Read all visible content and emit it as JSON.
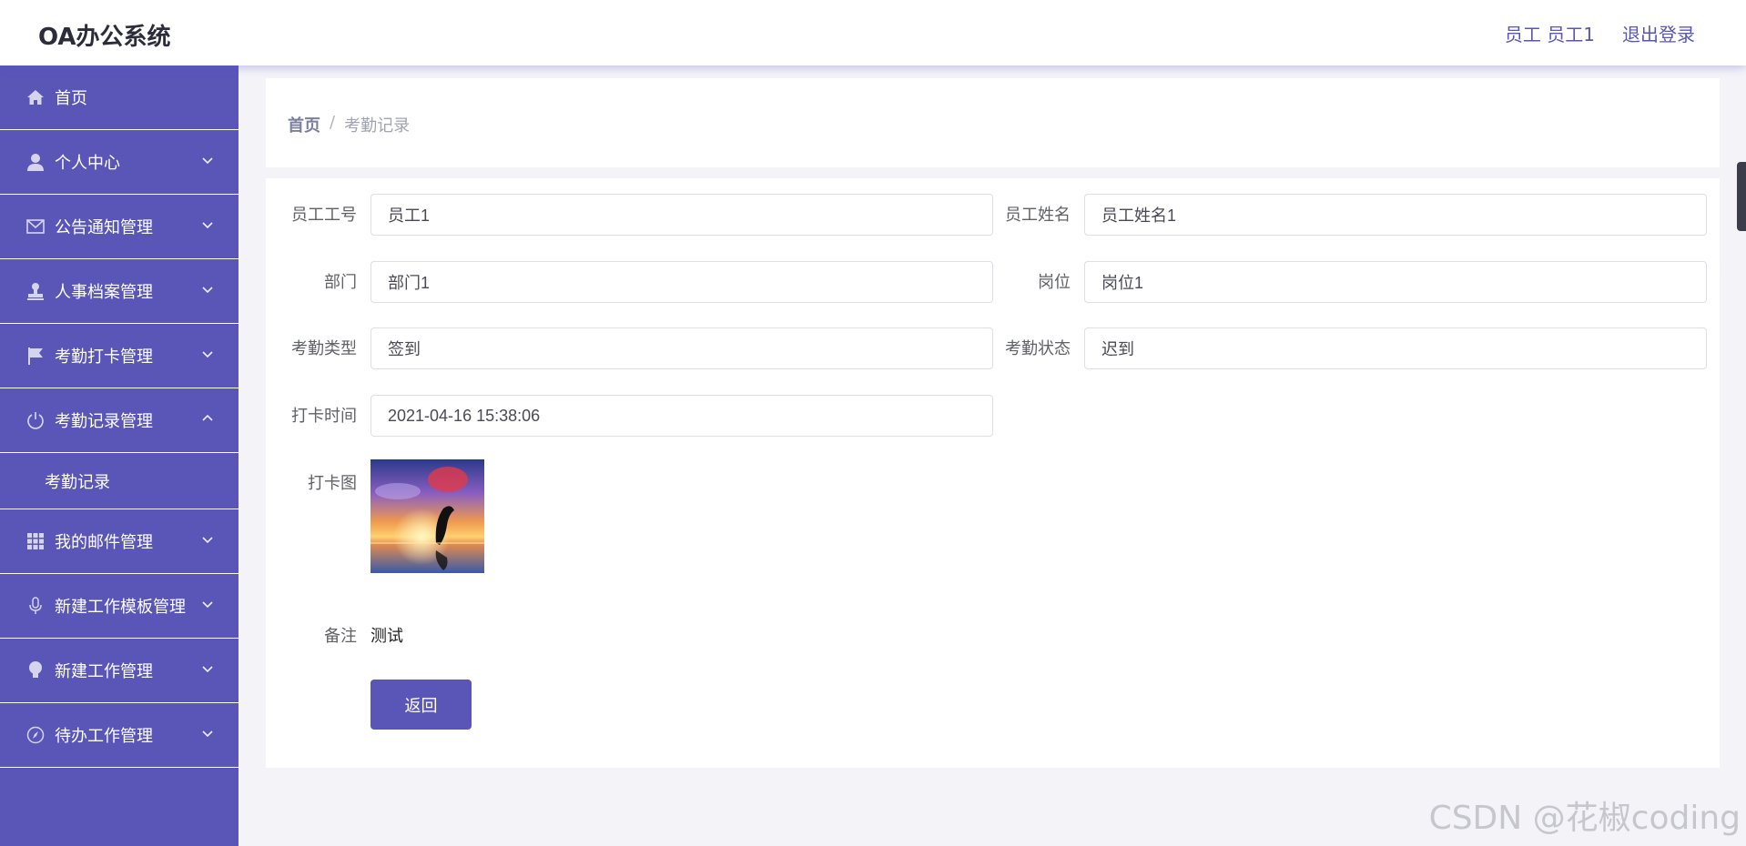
{
  "header": {
    "app_title": "OA办公系统",
    "user_label": "员工 员工1",
    "logout_label": "退出登录"
  },
  "sidebar": {
    "items": [
      {
        "label": "首页",
        "icon": "home-icon"
      },
      {
        "label": "个人中心",
        "icon": "user-icon"
      },
      {
        "label": "公告通知管理",
        "icon": "mail-icon"
      },
      {
        "label": "人事档案管理",
        "icon": "stamp-icon"
      },
      {
        "label": "考勤打卡管理",
        "icon": "flag-icon"
      },
      {
        "label": "考勤记录管理",
        "icon": "power-icon"
      },
      {
        "label": "我的邮件管理",
        "icon": "grid-icon"
      },
      {
        "label": "新建工作模板管理",
        "icon": "microphone-icon"
      },
      {
        "label": "新建工作管理",
        "icon": "bulb-icon"
      },
      {
        "label": "待办工作管理",
        "icon": "compass-icon"
      }
    ],
    "sub_item": "考勤记录"
  },
  "breadcrumb": {
    "home": "首页",
    "separator": "/",
    "current": "考勤记录"
  },
  "form": {
    "employee_no_label": "员工工号",
    "employee_no": "员工1",
    "employee_name_label": "员工姓名",
    "employee_name": "员工姓名1",
    "department_label": "部门",
    "department": "部门1",
    "position_label": "岗位",
    "position": "岗位1",
    "type_label": "考勤类型",
    "type": "签到",
    "status_label": "考勤状态",
    "status": "迟到",
    "time_label": "打卡时间",
    "time": "2021-04-16 15:38:06",
    "photo_label": "打卡图",
    "remark_label": "备注",
    "remark": "测试",
    "back_button": "返回"
  },
  "watermark": "CSDN @花椒coding",
  "colors": {
    "accent": "#5a56b8",
    "background": "#f4f4f8"
  }
}
